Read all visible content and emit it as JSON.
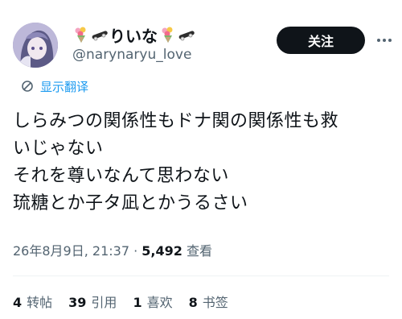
{
  "tweet": {
    "display_name_text": "りいな",
    "name_icons": [
      "bouquet-emoji",
      "skateboard-emoji",
      "bouquet-emoji",
      "skateboard-emoji"
    ],
    "handle": "@narynaryu_love",
    "follow_label": "关注",
    "translate_label": "显示翻译",
    "body_lines": [
      "しらみつの関係性もドナ関の関係性も救",
      "いじゃない",
      "それを尊いなんて思わない",
      "琉糖とか子タ凪とかうるさい"
    ],
    "timestamp": "26年8月9日, 21:37",
    "separator": " · ",
    "views_count": "5,492",
    "views_label": "查看",
    "stats": [
      {
        "count": "4",
        "label": "转帖"
      },
      {
        "count": "39",
        "label": "引用"
      },
      {
        "count": "1",
        "label": "喜欢"
      },
      {
        "count": "8",
        "label": "书签"
      }
    ]
  },
  "colors": {
    "text": "#0f1419",
    "secondary": "#536471",
    "link": "#1d9bf0",
    "button_bg": "#0f1419",
    "button_text": "#ffffff"
  }
}
